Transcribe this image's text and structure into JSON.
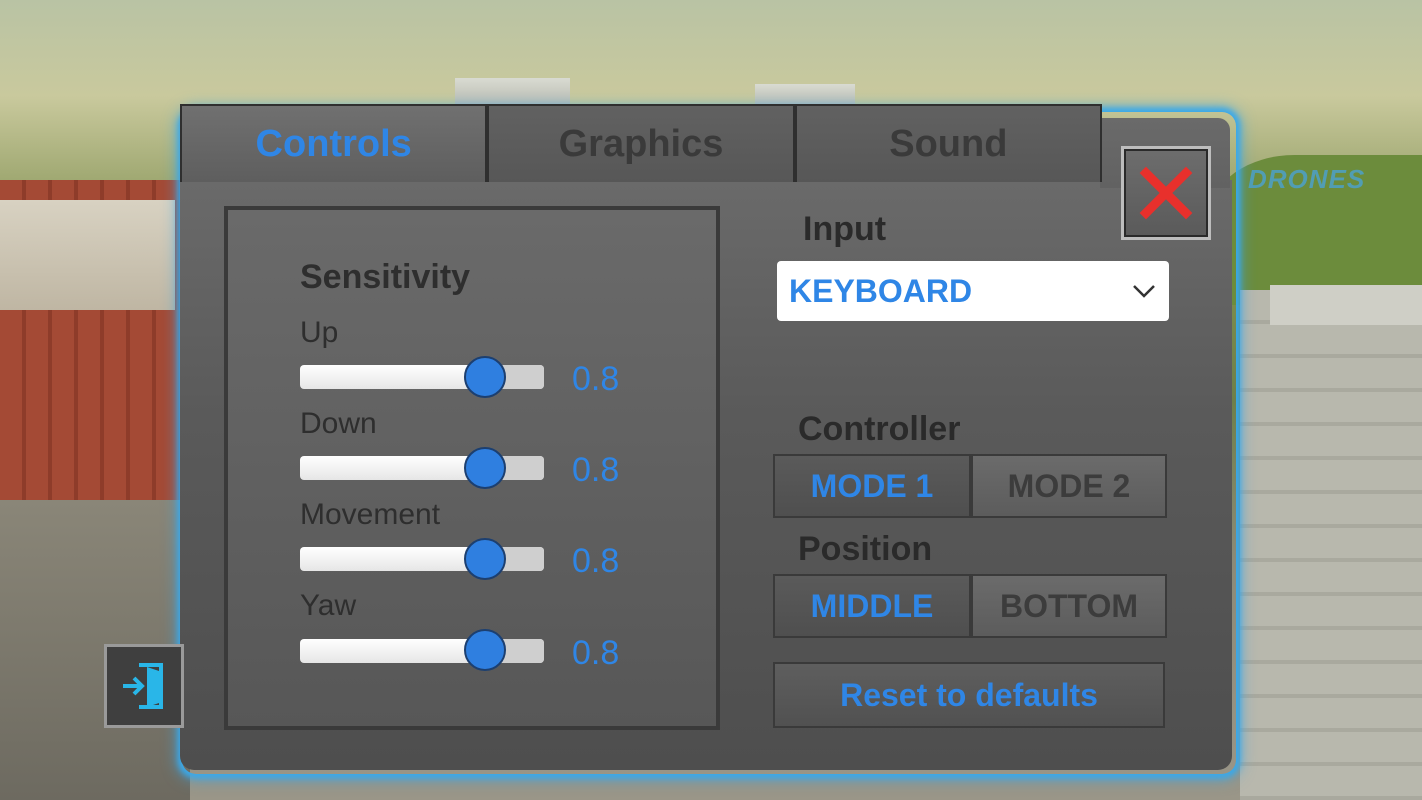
{
  "tabs": [
    {
      "label": "Controls",
      "active": true
    },
    {
      "label": "Graphics",
      "active": false
    },
    {
      "label": "Sound",
      "active": false
    }
  ],
  "background": {
    "sign_text": "DRONES"
  },
  "sensitivity": {
    "title": "Sensitivity",
    "sliders": [
      {
        "label": "Up",
        "value_text": "0.8",
        "level": 0.8
      },
      {
        "label": "Down",
        "value_text": "0.8",
        "level": 0.8
      },
      {
        "label": "Movement",
        "value_text": "0.8",
        "level": 0.8
      },
      {
        "label": "Yaw",
        "value_text": "0.8",
        "level": 0.8
      }
    ]
  },
  "input": {
    "label": "Input",
    "selected": "KEYBOARD"
  },
  "controller": {
    "label": "Controller",
    "options": [
      "MODE 1",
      "MODE 2"
    ],
    "selected": "MODE 1"
  },
  "position": {
    "label": "Position",
    "options": [
      "MIDDLE",
      "BOTTOM"
    ],
    "selected": "MIDDLE"
  },
  "reset_label": "Reset to defaults",
  "icons": {
    "close": "close-icon",
    "exit": "exit-door-icon",
    "dropdown": "chevron-down-icon"
  },
  "colors": {
    "accent": "#2f86e6",
    "glow": "#3aa9ea",
    "close_red": "#e8302c"
  }
}
